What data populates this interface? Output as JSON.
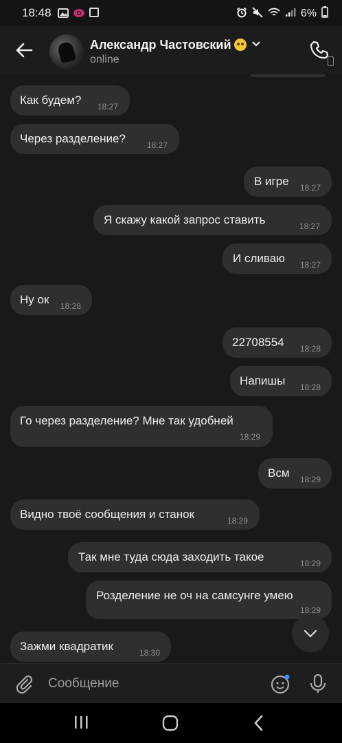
{
  "status_bar": {
    "time": "18:48",
    "battery": "6%",
    "icons": [
      "gallery-icon",
      "vpn-eye-icon",
      "screenshot-icon",
      "alarm-icon",
      "mute-icon",
      "wifi-icon",
      "signal-icon",
      "battery-icon"
    ]
  },
  "header": {
    "contact_name": "Александр Частовский",
    "status": "online"
  },
  "messages": [
    {
      "side": "in",
      "text": "Как будем?",
      "time": "18:27"
    },
    {
      "side": "in",
      "text": "Через разделение?",
      "time": "18:27"
    },
    {
      "side": "out",
      "text": "В игре",
      "time": "18:27"
    },
    {
      "side": "out",
      "text": "Я скажу какой запрос ставить",
      "time": "18:27"
    },
    {
      "side": "out",
      "text": "И сливаю",
      "time": "18:27"
    },
    {
      "side": "in",
      "text": "Ну ок",
      "time": "18:28"
    },
    {
      "side": "out",
      "text": "22708554",
      "time": "18:28"
    },
    {
      "side": "out",
      "text": "Напишы",
      "time": "18:28"
    },
    {
      "side": "in",
      "text": "Го через разделение? Мне так удобней",
      "time": "18:29"
    },
    {
      "side": "out",
      "text": "Всм",
      "time": "18:29"
    },
    {
      "side": "in",
      "text": "Видно твоё сообщения и станок",
      "time": "18:29"
    },
    {
      "side": "out",
      "text": "Так мне туда сюда заходить такое",
      "time": "18:29"
    },
    {
      "side": "out",
      "text": "Розделение не оч на самсунге умею",
      "time": "18:29"
    },
    {
      "side": "in",
      "text": "Зажми квадратик",
      "time": "18:30"
    }
  ],
  "composer": {
    "placeholder": "Сообщение"
  },
  "colors": {
    "background": "#191919",
    "bubble": "#2f2f2f",
    "time_text": "#8d8d8d",
    "notification_dot": "#3d8bfd"
  }
}
